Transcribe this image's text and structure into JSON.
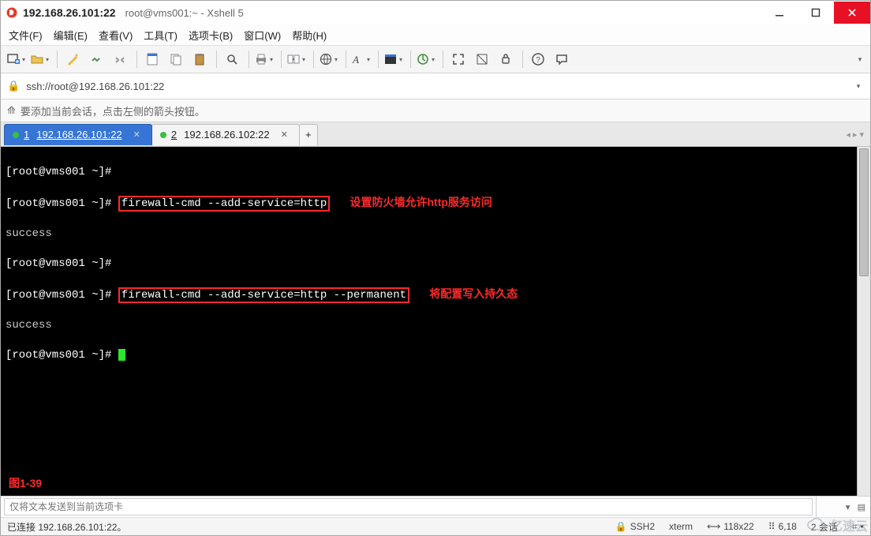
{
  "window": {
    "address": "192.168.26.101:22",
    "title_suffix": "root@vms001:~ - Xshell 5"
  },
  "menu": {
    "file": "文件(F)",
    "edit": "编辑(E)",
    "view": "查看(V)",
    "tools": "工具(T)",
    "tabs": "选项卡(B)",
    "window": "窗口(W)",
    "help": "帮助(H)"
  },
  "toolbar": {
    "icons": [
      "new-session",
      "open",
      "save",
      "sep",
      "wizard",
      "reconnect",
      "disconnect",
      "sep",
      "properties",
      "copy",
      "paste",
      "sep",
      "find",
      "sep",
      "print",
      "sep",
      "transfer",
      "sep",
      "encoding",
      "sep",
      "font",
      "sep",
      "colorscheme",
      "sep",
      "script",
      "sep",
      "fullscreen",
      "transparent",
      "lock",
      "sep",
      "help",
      "feedback"
    ]
  },
  "addressbar": {
    "url": "ssh://root@192.168.26.101:22"
  },
  "hintbar": {
    "text": "要添加当前会话，点击左侧的箭头按钮。"
  },
  "tabs": [
    {
      "index": "1",
      "label": "192.168.26.101:22",
      "active": true
    },
    {
      "index": "2",
      "label": "192.168.26.102:22",
      "active": false
    }
  ],
  "terminal": {
    "lines": [
      {
        "prompt": "[root@vms001 ~]#",
        "cmd": ""
      },
      {
        "prompt": "[root@vms001 ~]#",
        "cmd": "firewall-cmd --add-service=http",
        "boxed": true,
        "annotation": "设置防火墙允许http服务访问"
      },
      {
        "text": "success"
      },
      {
        "prompt": "[root@vms001 ~]#",
        "cmd": ""
      },
      {
        "prompt": "[root@vms001 ~]#",
        "cmd": "firewall-cmd --add-service=http --permanent",
        "boxed": true,
        "annotation": "将配置写入持久态"
      },
      {
        "text": "success"
      },
      {
        "prompt": "[root@vms001 ~]#",
        "cursor": true
      }
    ],
    "figure_label": "图1-39"
  },
  "sendbar": {
    "placeholder": "仅将文本发送到当前选项卡"
  },
  "statusbar": {
    "connected": "已连接 192.168.26.101:22。",
    "protocol": "SSH2",
    "term": "xterm",
    "size": "118x22",
    "cursor_pos": "6,18",
    "sessions": "2 会话"
  },
  "watermark": {
    "text": "亿速云"
  }
}
